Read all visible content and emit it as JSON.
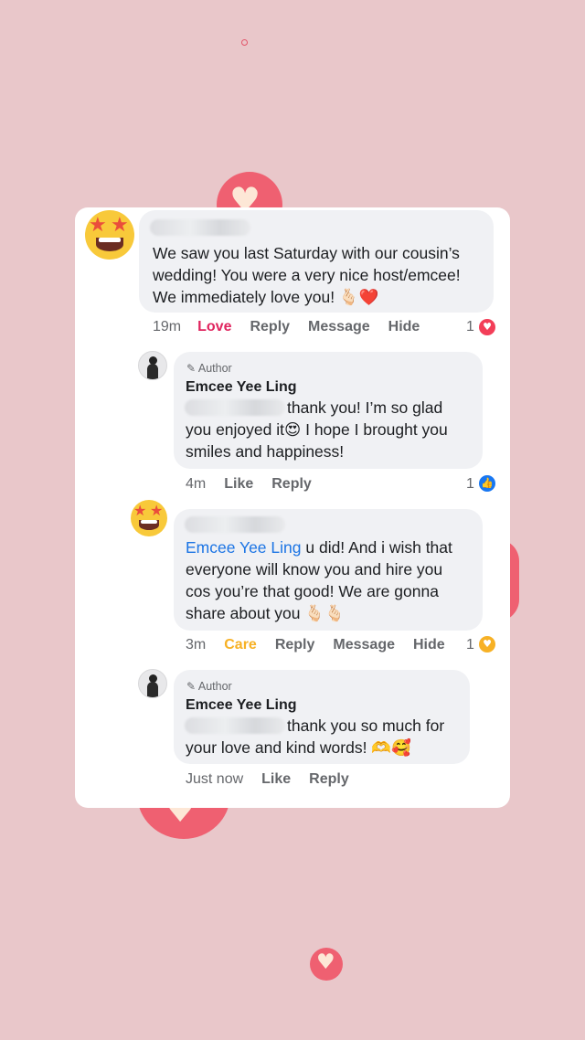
{
  "colors": {
    "background": "#e9c7ca",
    "accent_heart": "#ef6071",
    "love": "#e0245e",
    "care": "#f7b125",
    "mention": "#1b74e4",
    "like_blue": "#1877f2"
  },
  "comments": [
    {
      "avatar_icon": "star-struck-emoji-icon",
      "name_hidden": true,
      "text_lines": [
        "We saw you last Saturday with our cousin’s",
        "wedding! You were a very nice host/emcee!",
        "We immediately love you! 🫰🏻❤️"
      ],
      "meta": {
        "time": "19m",
        "reaction": "Love",
        "reply": "Reply",
        "message": "Message",
        "hide": "Hide"
      },
      "reaction_count": "1",
      "reaction_icon": "love-reaction-icon"
    },
    {
      "avatar_icon": "author-avatar",
      "author_badge": "Author",
      "name": "Emcee Yee Ling",
      "text_lines": [
        "thank you! I’m so glad",
        "you enjoyed it😍 I hope I brought you",
        "smiles and happiness!"
      ],
      "meta": {
        "time": "4m",
        "like": "Like",
        "reply": "Reply"
      },
      "reaction_count": "1",
      "reaction_icon": "like-reaction-icon"
    },
    {
      "avatar_icon": "star-struck-emoji-icon",
      "name_hidden": true,
      "mention": "Emcee Yee Ling",
      "text_lines": [
        " u did! And i wish that",
        "everyone will know you and hire you",
        "cos you’re that good! We are gonna",
        "share about you 🫰🏻🫰🏻"
      ],
      "meta": {
        "time": "3m",
        "reaction": "Care",
        "reply": "Reply",
        "message": "Message",
        "hide": "Hide"
      },
      "reaction_count": "1",
      "reaction_icon": "care-reaction-icon"
    },
    {
      "avatar_icon": "author-avatar",
      "author_badge": "Author",
      "name": "Emcee Yee Ling",
      "text_lines": [
        "thank you so much for",
        "your love and kind words! 🫶🥰"
      ],
      "meta": {
        "time": "Just now",
        "like": "Like",
        "reply": "Reply"
      }
    }
  ]
}
